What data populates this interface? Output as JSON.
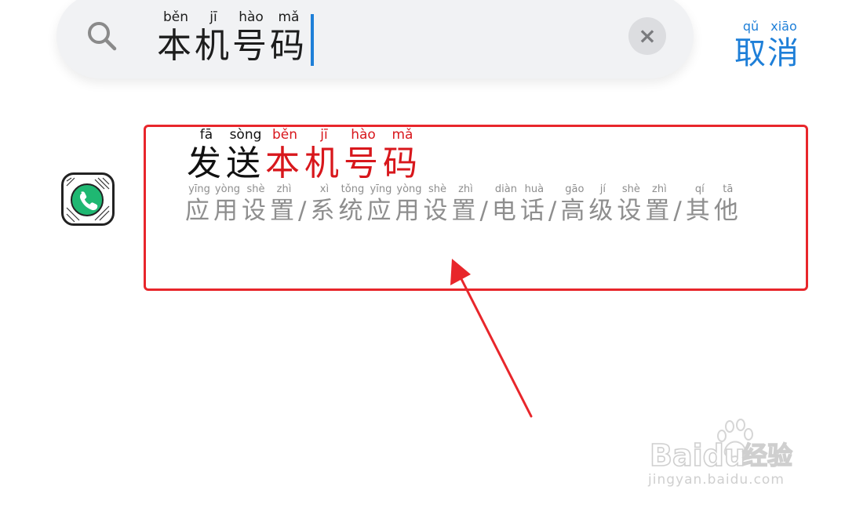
{
  "search": {
    "icon": "search-icon",
    "query_chars": [
      {
        "char": "本",
        "pinyin": "běn"
      },
      {
        "char": "机",
        "pinyin": "jī"
      },
      {
        "char": "号",
        "pinyin": "hào"
      },
      {
        "char": "码",
        "pinyin": "mǎ"
      }
    ],
    "clear_icon": "close-icon",
    "clear_glyph": "×",
    "cancel_chars": [
      {
        "char": "取",
        "pinyin": "qǔ"
      },
      {
        "char": "消",
        "pinyin": "xiāo"
      }
    ]
  },
  "result": {
    "app_icon": "phone-app-icon",
    "title_chars": [
      {
        "char": "发",
        "pinyin": "fā",
        "highlight": false
      },
      {
        "char": "送",
        "pinyin": "sòng",
        "highlight": false
      },
      {
        "char": "本",
        "pinyin": "běn",
        "highlight": true
      },
      {
        "char": "机",
        "pinyin": "jī",
        "highlight": true
      },
      {
        "char": "号",
        "pinyin": "hào",
        "highlight": true
      },
      {
        "char": "码",
        "pinyin": "mǎ",
        "highlight": true
      }
    ],
    "path_chars": [
      {
        "char": "应",
        "pinyin": "yīng"
      },
      {
        "char": "用",
        "pinyin": "yòng"
      },
      {
        "char": "设",
        "pinyin": "shè"
      },
      {
        "char": "置",
        "pinyin": "zhì"
      },
      {
        "char": "/",
        "pinyin": ""
      },
      {
        "char": "系",
        "pinyin": "xì"
      },
      {
        "char": "统",
        "pinyin": "tǒng"
      },
      {
        "char": "应",
        "pinyin": "yīng"
      },
      {
        "char": "用",
        "pinyin": "yòng"
      },
      {
        "char": "设",
        "pinyin": "shè"
      },
      {
        "char": "置",
        "pinyin": "zhì"
      },
      {
        "char": "/",
        "pinyin": ""
      },
      {
        "char": "电",
        "pinyin": "diàn"
      },
      {
        "char": "话",
        "pinyin": "huà"
      },
      {
        "char": "/",
        "pinyin": ""
      },
      {
        "char": "高",
        "pinyin": "gāo"
      },
      {
        "char": "级",
        "pinyin": "jí"
      },
      {
        "char": "设",
        "pinyin": "shè"
      },
      {
        "char": "置",
        "pinyin": "zhì"
      },
      {
        "char": "/",
        "pinyin": ""
      },
      {
        "char": "其",
        "pinyin": "qí"
      },
      {
        "char": "他",
        "pinyin": "tā"
      }
    ]
  },
  "colors": {
    "accent": "#1e7fd8",
    "highlight": "#d8171c",
    "annotation": "#e8262b",
    "path_text": "#8e8e8e"
  },
  "watermark": {
    "brand": "Baidu",
    "brand_cn": "经验",
    "url": "jingyan.baidu.com"
  }
}
